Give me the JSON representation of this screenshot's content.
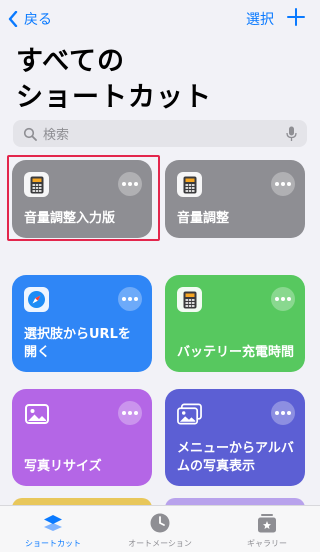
{
  "nav": {
    "back_label": "戻る",
    "select_label": "選択"
  },
  "page_title": "すべての\nショートカット",
  "search": {
    "placeholder": "検索"
  },
  "shortcuts": [
    {
      "label": "音量調整入力版",
      "color": "#8e8e93",
      "icon": "calculator-icon"
    },
    {
      "label": "音量調整",
      "color": "#8e8e93",
      "icon": "calculator-icon"
    },
    {
      "label": "選択肢からURLを開く",
      "color": "#2f86f6",
      "icon": "safari-compass-icon"
    },
    {
      "label": "バッテリー充電時間",
      "color": "#57c85f",
      "icon": "calculator-icon"
    },
    {
      "label": "写真リサイズ",
      "color": "#b466e6",
      "icon": "photo-icon"
    },
    {
      "label": "メニューからアルバムの写真表示",
      "color": "#5c5fd4",
      "icon": "photos-stack-icon"
    }
  ],
  "tabbar": {
    "items": [
      {
        "label": "ショートカット",
        "icon": "layers-icon",
        "active": true
      },
      {
        "label": "オートメーション",
        "icon": "clock-icon",
        "active": false
      },
      {
        "label": "ギャラリー",
        "icon": "gallery-icon",
        "active": false
      }
    ]
  },
  "colors": {
    "accent": "#0a7aff",
    "highlight": "#e3264c"
  }
}
